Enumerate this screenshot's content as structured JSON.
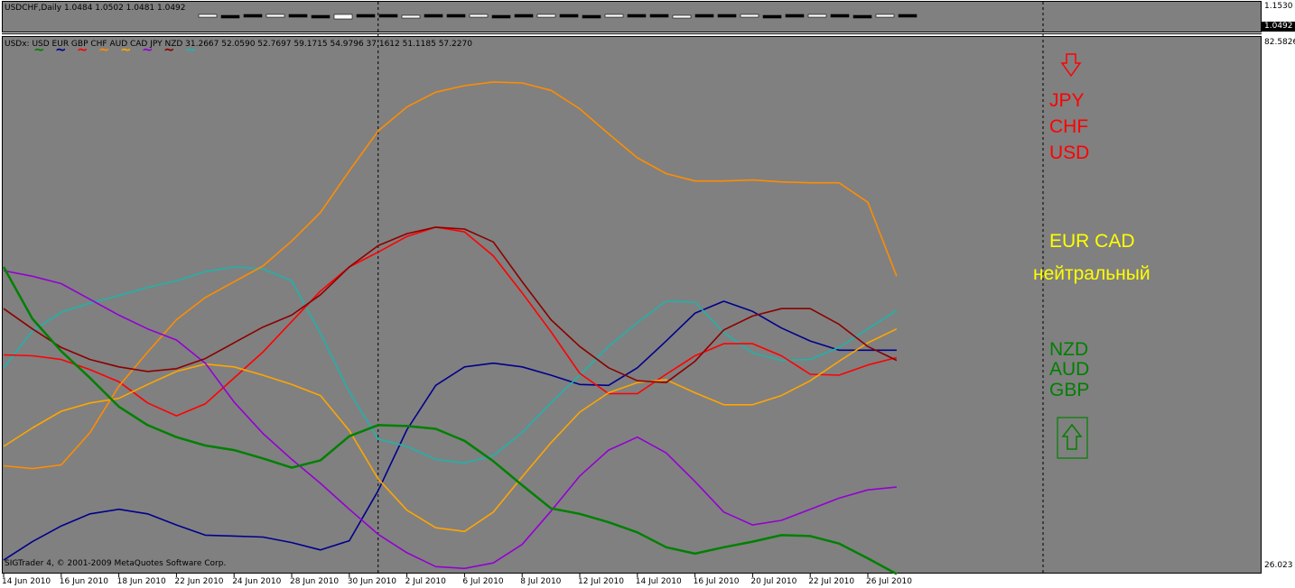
{
  "top_chart": {
    "title": "USDCHF,Daily  1.0484 1.0502 1.0481 1.0492",
    "scale_max": "1.1530",
    "current_price": "1.0492"
  },
  "indicator": {
    "title": "USDx: USD EUR GBP CHF AUD CAD JPY NZD 31.2667 52.0590 52.7697 59.1715 54.9796 37.1612 51.1185 57.2270",
    "scale_max": "82.5826",
    "scale_min": "26.023",
    "copyright": "SIGTrader 4, © 2001-2009 MetaQuotes Software Corp."
  },
  "legend_tildes": [
    {
      "glyph": "~",
      "color": "#008000"
    },
    {
      "glyph": "~",
      "color": "#00008b"
    },
    {
      "glyph": "~",
      "color": "#ff0000"
    },
    {
      "glyph": "~",
      "color": "#ff8c00"
    },
    {
      "glyph": "~",
      "color": "#ffa500"
    },
    {
      "glyph": "~",
      "color": "#9400d3"
    },
    {
      "glyph": "~",
      "color": "#8b0000"
    },
    {
      "glyph": "~",
      "color": "#20b2aa"
    }
  ],
  "annotations": {
    "weak_group": [
      "JPY",
      "CHF",
      "USD"
    ],
    "weak_color": "#ff0000",
    "neutral_group": "EUR  CAD",
    "neutral_label": "нейтральный",
    "neutral_color": "#ffff00",
    "strong_group": [
      "NZD",
      "AUD",
      "GBP"
    ],
    "strong_color": "#008000",
    "down_arrow_icon": "down-arrow-icon",
    "up_arrow_icon": "up-arrow-icon"
  },
  "chart_data": {
    "type": "line",
    "title": "USDx: USD EUR GBP CHF AUD CAD JPY NZD",
    "x": [
      "14 Jun 2010",
      "15 Jun 2010",
      "16 Jun 2010",
      "17 Jun 2010",
      "18 Jun 2010",
      "21 Jun 2010",
      "22 Jun 2010",
      "23 Jun 2010",
      "24 Jun 2010",
      "25 Jun 2010",
      "28 Jun 2010",
      "29 Jun 2010",
      "30 Jun 2010",
      "1 Jul 2010",
      "2 Jul 2010",
      "5 Jul 2010",
      "6 Jul 2010",
      "7 Jul 2010",
      "8 Jul 2010",
      "9 Jul 2010",
      "12 Jul 2010",
      "13 Jul 2010",
      "14 Jul 2010",
      "15 Jul 2010",
      "16 Jul 2010",
      "19 Jul 2010",
      "20 Jul 2010",
      "21 Jul 2010",
      "22 Jul 2010",
      "23 Jul 2010",
      "26 Jul 2010",
      "27 Jul 2010"
    ],
    "x_tick_labels": [
      "14 Jun 2010",
      "16 Jun 2010",
      "18 Jun 2010",
      "22 Jun 2010",
      "24 Jun 2010",
      "28 Jun 2010",
      "30 Jun 2010",
      "2 Jul 2010",
      "6 Jul 2010",
      "8 Jul 2010",
      "12 Jul 2010",
      "14 Jul 2010",
      "16 Jul 2010",
      "20 Jul 2010",
      "22 Jul 2010",
      "26 Jul 2010"
    ],
    "ylim": [
      26.023,
      82.5826
    ],
    "series": [
      {
        "name": "USD",
        "color": "#00008b",
        "values": [
          26.5,
          28.5,
          30.2,
          31.5,
          32.0,
          31.5,
          30.3,
          29.2,
          29.1,
          29.0,
          28.4,
          27.6,
          28.6,
          34.0,
          40.6,
          45.4,
          47.4,
          47.8,
          47.4,
          46.5,
          45.5,
          45.4,
          47.3,
          50.2,
          53.2,
          54.5,
          53.4,
          51.6,
          50.2,
          49.2,
          49.2,
          49.2
        ]
      },
      {
        "name": "EUR",
        "color": "#20b2aa",
        "values": [
          47.3,
          51.3,
          53.3,
          54.3,
          55.1,
          56.0,
          56.7,
          57.7,
          58.2,
          58.0,
          56.7,
          51.0,
          44.7,
          39.6,
          38.8,
          37.4,
          37.0,
          37.8,
          40.3,
          43.5,
          46.5,
          49.6,
          52.2,
          54.5,
          54.4,
          51.1,
          48.9,
          48.1,
          48.2,
          49.5,
          51.5,
          53.5
        ]
      },
      {
        "name": "GBP",
        "color": "#ff0000",
        "values": [
          48.7,
          48.6,
          48.2,
          47.1,
          45.8,
          43.5,
          42.1,
          43.4,
          46.2,
          49.0,
          52.3,
          55.6,
          58.2,
          59.8,
          61.5,
          62.5,
          62.0,
          59.4,
          55.4,
          51.2,
          46.7,
          44.5,
          44.5,
          46.6,
          48.6,
          49.9,
          49.9,
          48.6,
          46.6,
          46.5,
          47.6,
          48.4
        ]
      },
      {
        "name": "CHF",
        "color": "#ff8c00",
        "values": [
          36.7,
          36.4,
          36.8,
          40.3,
          45.3,
          49.0,
          52.5,
          54.9,
          56.6,
          58.3,
          61.0,
          64.1,
          68.6,
          72.9,
          75.5,
          77.1,
          77.8,
          78.2,
          78.1,
          77.3,
          75.3,
          72.6,
          70.0,
          68.3,
          67.5,
          67.5,
          67.6,
          67.4,
          67.3,
          67.3,
          65.2,
          57.2
        ]
      },
      {
        "name": "AUD",
        "color": "#ffa500",
        "values": [
          38.8,
          40.8,
          42.6,
          43.5,
          44.0,
          45.5,
          46.9,
          47.7,
          47.4,
          46.5,
          45.5,
          44.3,
          40.5,
          35.3,
          31.9,
          30.0,
          29.6,
          31.7,
          35.5,
          39.2,
          42.5,
          44.6,
          45.7,
          46.0,
          44.6,
          43.3,
          43.3,
          44.3,
          45.9,
          48.0,
          50.0,
          51.5
        ]
      },
      {
        "name": "CAD",
        "color": "#9400d3",
        "values": [
          57.8,
          57.2,
          56.4,
          54.7,
          53.0,
          51.5,
          50.3,
          47.8,
          43.6,
          40.2,
          37.4,
          34.8,
          32.0,
          29.3,
          27.3,
          25.8,
          25.6,
          26.2,
          28.2,
          31.8,
          35.6,
          38.4,
          39.8,
          38.1,
          35.0,
          31.7,
          30.3,
          30.8,
          32.0,
          33.2,
          34.1,
          34.4
        ]
      },
      {
        "name": "JPY",
        "color": "#8b0000",
        "values": [
          53.7,
          51.5,
          49.5,
          48.2,
          47.4,
          46.9,
          47.2,
          48.3,
          50.0,
          51.7,
          53.0,
          55.2,
          58.2,
          60.5,
          61.8,
          62.5,
          62.3,
          60.9,
          56.6,
          52.5,
          49.6,
          47.3,
          45.9,
          45.7,
          48.0,
          51.4,
          52.9,
          53.7,
          53.7,
          52.0,
          49.6,
          48.1
        ]
      },
      {
        "name": "NZD",
        "color": "#008000",
        "values": [
          58.2,
          52.6,
          49.1,
          46.2,
          43.1,
          41.1,
          39.8,
          38.9,
          38.4,
          37.5,
          36.5,
          37.3,
          39.9,
          41.1,
          41.0,
          40.7,
          39.4,
          37.2,
          34.6,
          32.1,
          31.5,
          30.6,
          29.5,
          27.9,
          27.2,
          27.9,
          28.5,
          29.2,
          29.1,
          28.3,
          26.7,
          25.0
        ]
      }
    ]
  }
}
